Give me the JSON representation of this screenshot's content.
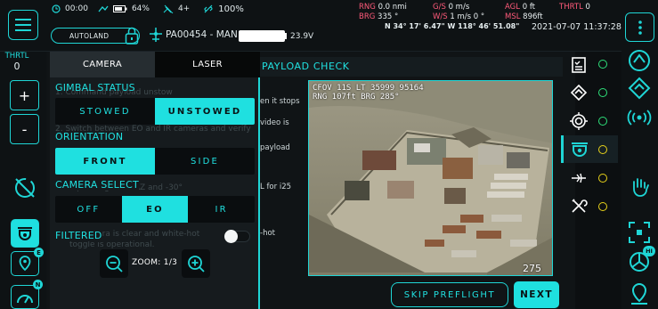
{
  "status": {
    "time": "00:00",
    "battery": "64%",
    "signal": "4+",
    "link": "100%",
    "mode_button": "AUTOLAND",
    "aircraft": "PA00454 - MAN",
    "voltage": "23.9V"
  },
  "telemetry": {
    "rng_label": "RNG",
    "rng_value": "0.0 nmi",
    "brg_label": "BRG",
    "brg_value": "335 °",
    "gs_label": "G/S",
    "gs_value": "0 m/s",
    "ws_label": "W/S",
    "ws_value": "1 m/s 0 °",
    "agl_label": "AGL",
    "agl_value": "0 ft",
    "msl_label": "MSL",
    "msl_value": "896ft",
    "thrtl_label": "THRTL",
    "thrtl_value": "0",
    "coords": "N 34° 17' 6.47\" W 118° 46' 51.08\"",
    "datetime": "2021-07-07 11:37:28"
  },
  "left_rail": {
    "thrtl_label": "THRTL",
    "thrtl_value": "0",
    "plus": "+",
    "minus": "-",
    "badge_e": "E",
    "badge_n": "N"
  },
  "main": {
    "title": "PAYLOAD CHECK",
    "bg_lines": [
      "en it stops",
      "video is",
      "payload",
      "L for i25",
      "-hot"
    ],
    "overlay_line1": "CFOV 11S LT 35999 95164",
    "overlay_line2": "RNG 107ft BRG 285°",
    "range_readout": "275 M",
    "skip_button": "SKIP PREFLIGHT",
    "next_button": "NEXT"
  },
  "panel": {
    "tab_camera": "CAMERA",
    "tab_laser": "LASER",
    "gimbal_label": "GIMBAL STATUS",
    "gimbal_ghost": "1. Command payload unstow",
    "gimbal_options": [
      "STOWED",
      "UNSTOWED"
    ],
    "gimbal_selected": "UNSTOWED",
    "orientation_label": "ORIENTATION",
    "orientation_ghost": "2. Switch between EO and IR cameras and verify",
    "orientation_options": [
      "FRONT",
      "SIDE"
    ],
    "orientation_selected": "FRONT",
    "camera_label": "CAMERA SELECT",
    "camera_ghost": "ad is pointing at 0° AZ and -30°",
    "camera_options": [
      "OFF",
      "EO",
      "IR"
    ],
    "camera_selected": "EO",
    "filtered_label": "FILTERED",
    "filtered_ghost1": "ry camera is clear and white-hot",
    "filtered_ghost2": "toggle is operational.",
    "zoom_label": "ZOOM: 1/3"
  },
  "right_badge": "HI",
  "colors": {
    "accent": "#1fe0e0",
    "accent_pink": "#ff5a7a",
    "check_green": "#2ee07a",
    "pending_yellow": "#e8d21a"
  }
}
